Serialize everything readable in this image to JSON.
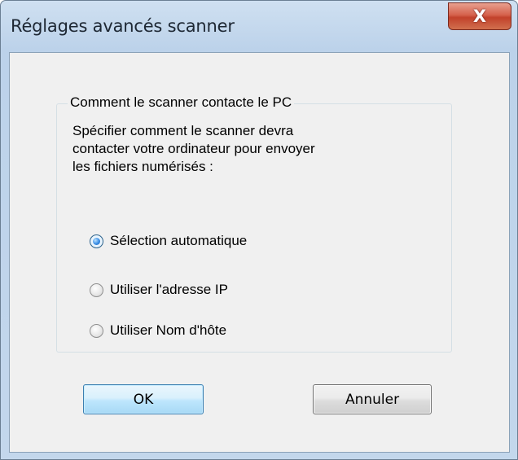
{
  "window": {
    "title": "Réglages avancés scanner",
    "close_glyph": "X"
  },
  "group": {
    "legend": "Comment le scanner contacte le PC",
    "description_lines": [
      "Spécifier comment le scanner devra",
      "contacter votre ordinateur pour envoyer",
      "les fichiers numérisés :"
    ],
    "options": [
      {
        "label": "Sélection automatique",
        "checked": true
      },
      {
        "label": "Utiliser l'adresse IP",
        "checked": false
      },
      {
        "label": "Utiliser Nom d'hôte",
        "checked": false
      }
    ]
  },
  "buttons": {
    "ok": "OK",
    "cancel": "Annuler"
  },
  "colors": {
    "title_bar": "#bcd2ea",
    "client_bg": "#f0f0f0",
    "close_red": "#c2412b",
    "ok_border": "#3c7fb1"
  }
}
